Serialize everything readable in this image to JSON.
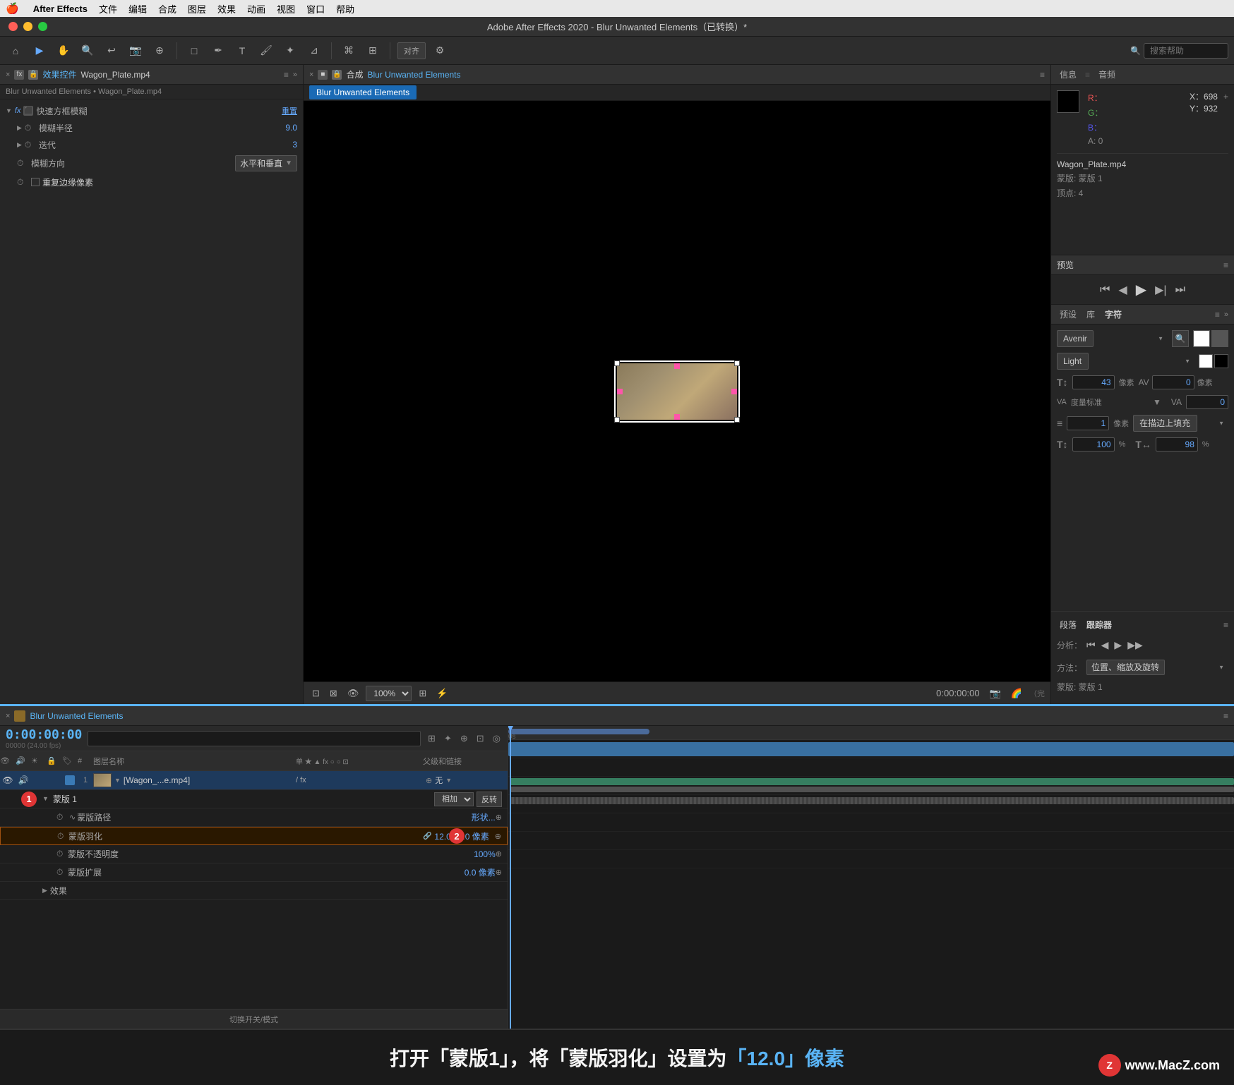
{
  "menuBar": {
    "apple": "🍎",
    "appName": "After Effects",
    "items": [
      "文件",
      "编辑",
      "合成",
      "图层",
      "效果",
      "动画",
      "视图",
      "窗口",
      "帮助"
    ]
  },
  "titleBar": {
    "title": "Adobe After Effects 2020 - Blur Unwanted Elements（已转换）*"
  },
  "leftPanel": {
    "closeBtn": "×",
    "icon": "fx",
    "lockedIcon": "🔒",
    "title": "效果控件",
    "fileName": "Wagon_Plate.mp4",
    "menuIcon": "≡",
    "expandIcon": "»",
    "breadcrumb": "Blur Unwanted Elements • Wagon_Plate.mp4",
    "fxLabel": "fx",
    "fastBoxBlurLabel": "快速方框模糊",
    "resetLabel": "重置",
    "blurRadius": {
      "label": "模糊半径",
      "value": "9.0"
    },
    "iterations": {
      "label": "迭代",
      "value": "3"
    },
    "blurDimension": {
      "label": "模糊方向",
      "value": "水平和垂直",
      "hasDropdown": true
    },
    "repeatEdge": {
      "label": "重复边缘像素",
      "checked": false
    }
  },
  "compPanel": {
    "closeBtn": "×",
    "icon": "🔒",
    "title": "合成",
    "compName": "Blur Unwanted Elements",
    "menuIcon": "≡",
    "expandIcon": "»",
    "compNameLabel": "Blur Unwanted Elements"
  },
  "viewerToolbar": {
    "zoomLabel": "100%",
    "timeCode": "0:00:00:00",
    "items": [
      "📷",
      "🔗",
      "▶"
    ]
  },
  "infoPanel": {
    "title": "信息",
    "audioTitle": "音频",
    "r": "R：",
    "g": "G：",
    "b": "B：",
    "a": "A: 0",
    "x": "X：698",
    "y": "Y：932",
    "addSign": "+",
    "sourceName": "Wagon_Plate.mp4",
    "maskLabel": "蒙版: 蒙版 1",
    "vertices": "顶点: 4"
  },
  "previewPanel": {
    "title": "预览",
    "menuIcon": "≡",
    "buttons": [
      "⏮",
      "◀",
      "▶",
      "▶▶",
      "⏭"
    ]
  },
  "characterPanel": {
    "title": "预设",
    "libraryTitle": "库",
    "charTitle": "字符",
    "menuIcon": "≡",
    "expandIcon": "»",
    "fontFamily": "Avenir",
    "fontStyle": "Light",
    "fontSize": "43",
    "fontSizeUnit": "像素",
    "kerning": "0",
    "kerningUnit": "像素",
    "trackingLabel": "度量标准",
    "trackingValue": "0",
    "strokeWidth": "1",
    "strokeWidthUnit": "像素",
    "strokeFill": "在描边上填充",
    "vertScale": "100",
    "horizScale": "98"
  },
  "trackerPanel": {
    "title": "段落",
    "trackerTitle": "跟踪器",
    "menuIcon": "≡",
    "analyzeLabel": "分析：",
    "methodLabel": "方法：",
    "methodValue": "位置、缩放及旋转",
    "maskLabel": "蒙版: 蒙版 1",
    "trackerBtns": [
      "⏮",
      "◀",
      "▶",
      "▶▶"
    ]
  },
  "timeline": {
    "closeBtn": "×",
    "icon": "■",
    "compName": "Blur Unwanted Elements",
    "menuIcon": "≡",
    "timeCode": "0:00:00:00",
    "fps": "00000 (24.00 fps)",
    "searchPlaceholder": "",
    "columns": {
      "layerName": "图层名称",
      "switches": "单 ★ ▲ fx ○ ○ ⊡",
      "parent": "父级和链接"
    },
    "layers": [
      {
        "num": "1",
        "name": "[Wagon_...e.mp4]",
        "colorLabel": "blue",
        "hasDropdown": true,
        "switches": "/ fx",
        "parentValue": "无",
        "isVideo": true
      }
    ],
    "subLayers": [
      {
        "indent": 1,
        "label": "蒙版 1",
        "value": "",
        "blendMode": "相加",
        "hasInvert": true,
        "invertLabel": "反转"
      },
      {
        "indent": 2,
        "label": "蒙版路径",
        "value": "形状...",
        "highlighted": false
      },
      {
        "indent": 2,
        "label": "蒙版羽化",
        "value": "12.0,12.0 像素",
        "highlighted": true,
        "hasLink": true
      },
      {
        "indent": 2,
        "label": "蒙版不透明度",
        "value": "100%",
        "highlighted": false
      },
      {
        "indent": 2,
        "label": "蒙版扩展",
        "value": "0.0 像素",
        "highlighted": false
      },
      {
        "indent": 1,
        "label": "效果",
        "value": "",
        "isGroup": true
      }
    ],
    "bottomControls": "切换开关/模式"
  },
  "badges": [
    {
      "num": "1",
      "color": "red"
    },
    {
      "num": "2",
      "color": "red"
    }
  ],
  "instruction": {
    "text1": "打开「蒙版1」，将「蒙版羽化」设置为",
    "highlight": "「12.0」像素"
  },
  "watermark": {
    "icon": "Z",
    "text": "www.MacZ.com"
  }
}
